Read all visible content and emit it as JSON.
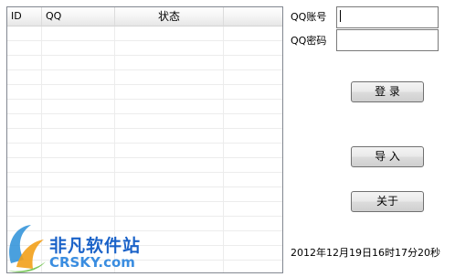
{
  "list": {
    "columns": [
      "ID",
      "QQ",
      "状态",
      ""
    ],
    "rows": []
  },
  "form": {
    "qq_account_label": "QQ账号",
    "qq_password_label": "QQ密码",
    "qq_account_value": "",
    "qq_password_value": ""
  },
  "buttons": {
    "login": "登  录",
    "import": "导  入",
    "about": "关于"
  },
  "status": {
    "datetime": "2012年12月19日16时17分20秒"
  },
  "watermark": {
    "text": "非凡软件站",
    "url": "CRSKY.com"
  }
}
